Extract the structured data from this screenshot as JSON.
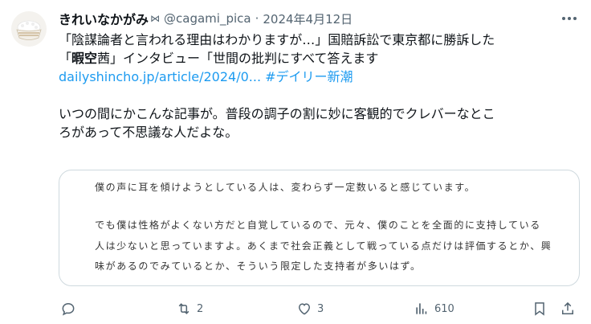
{
  "tweet": {
    "author_name": "きれいなかがみ",
    "name_emoji": "⋈",
    "handle": "@cagami_pica",
    "separator": "·",
    "date": "2024年4月12日",
    "line1": "「陰謀論者と言われる理由はわかりますが…」国賠訴訟で東京都に勝訴した",
    "line2_pre": "「",
    "line2_bold": "暇空",
    "line2_post": "茜」インタビュー「世間の批判にすべて答えます",
    "link_text": "dailyshincho.jp/article/2024/0...",
    "hashtag": "#デイリー新潮",
    "comment_line1": "いつの間にかこんな記事が。普段の調子の割に妙に客観的でクレバーなとこ",
    "comment_line2": "ろがあって不思議な人だよな。"
  },
  "card": {
    "line1": "僕の声に耳を傾けようとしている人は、変わらず一定数いると感じています。",
    "line2": "でも僕は性格がよくない方だと自覚しているので、元々、僕のことを全面的に支持している",
    "line3": "人は少ないと思っていますよ。あくまで社会正義として戦っている点だけは評価するとか、興",
    "line4": "味があるのでみているとか、そういう限定した支持者が多いはず。"
  },
  "actions": {
    "replies": "",
    "retweets": "2",
    "likes": "3",
    "views": "610"
  },
  "colors": {
    "accent": "#1d9bf0",
    "secondary_text": "#536471",
    "border": "#cfd9de"
  }
}
